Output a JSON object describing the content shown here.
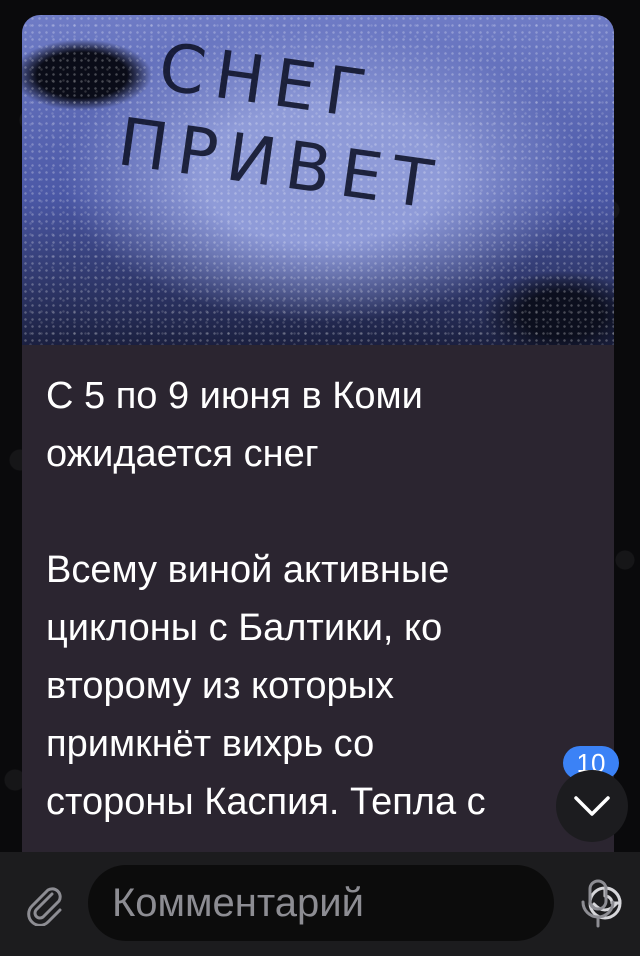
{
  "post": {
    "image_text": [
      "СНЕГ",
      "ПРИВЕТ"
    ],
    "caption_title_lines": [
      "С 5 по 9 июня в Коми",
      "ожидается снег"
    ],
    "caption_body_lines": [
      "Всему виной активные",
      "циклоны с Балтики, ко",
      "второму из которых",
      "примкнёт вихрь со",
      "стороны Каспия. Тепла с"
    ]
  },
  "composer": {
    "placeholder": "Комментарий",
    "attach_icon": "paperclip-icon",
    "sticker_icon": "sticker-icon",
    "mic_icon": "microphone-icon"
  },
  "scroll": {
    "unread_count": "10",
    "icon": "chevron-down-icon"
  },
  "colors": {
    "accent": "#3b82f6",
    "bubble": "#2b2530",
    "background": "#0a0a0c"
  }
}
